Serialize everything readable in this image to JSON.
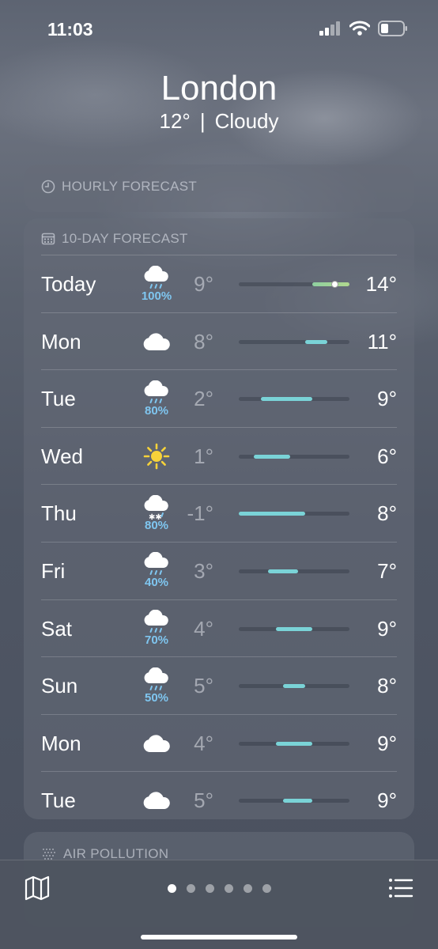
{
  "status": {
    "time": "11:03"
  },
  "location": {
    "city": "London",
    "temp": "12°",
    "separator": "|",
    "condition": "Cloudy"
  },
  "hourly": {
    "title": "HOURLY FORECAST"
  },
  "tenday": {
    "title": "10-DAY FORECAST",
    "range_min": -1,
    "range_max": 14,
    "days": [
      {
        "day": "Today",
        "icon": "rain-cloud-icon",
        "precip": "100%",
        "low": "9°",
        "high": "14°",
        "low_val": 9,
        "high_val": 14,
        "current_val": 12
      },
      {
        "day": "Mon",
        "icon": "cloud-icon",
        "precip": "",
        "low": "8°",
        "high": "11°",
        "low_val": 8,
        "high_val": 11
      },
      {
        "day": "Tue",
        "icon": "rain-cloud-icon",
        "precip": "80%",
        "low": "2°",
        "high": "9°",
        "low_val": 2,
        "high_val": 9
      },
      {
        "day": "Wed",
        "icon": "sun-icon",
        "precip": "",
        "low": "1°",
        "high": "6°",
        "low_val": 1,
        "high_val": 6
      },
      {
        "day": "Thu",
        "icon": "snow-cloud-icon",
        "precip": "80%",
        "low": "-1°",
        "high": "8°",
        "low_val": -1,
        "high_val": 8
      },
      {
        "day": "Fri",
        "icon": "rain-cloud-icon",
        "precip": "40%",
        "low": "3°",
        "high": "7°",
        "low_val": 3,
        "high_val": 7
      },
      {
        "day": "Sat",
        "icon": "rain-cloud-icon",
        "precip": "70%",
        "low": "4°",
        "high": "9°",
        "low_val": 4,
        "high_val": 9
      },
      {
        "day": "Sun",
        "icon": "rain-cloud-icon",
        "precip": "50%",
        "low": "5°",
        "high": "8°",
        "low_val": 5,
        "high_val": 8
      },
      {
        "day": "Mon",
        "icon": "cloud-icon",
        "precip": "",
        "low": "4°",
        "high": "9°",
        "low_val": 4,
        "high_val": 9
      },
      {
        "day": "Tue",
        "icon": "cloud-icon",
        "precip": "",
        "low": "5°",
        "high": "9°",
        "low_val": 5,
        "high_val": 9
      }
    ]
  },
  "air": {
    "title": "AIR POLLUTION"
  },
  "pager": {
    "count": 6,
    "active_index": 0
  },
  "colors": {
    "bar_fill": "#7ad3d7",
    "precip_text": "#7fc6f0",
    "sun": "#f6d23a"
  }
}
